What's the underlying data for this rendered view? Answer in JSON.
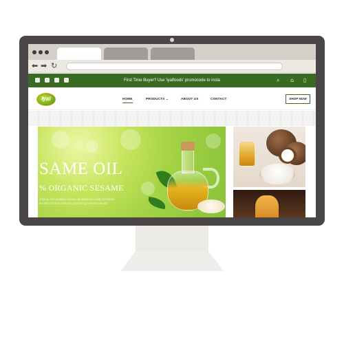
{
  "browser": {
    "nav": {
      "back_icon": "arrow-left-icon",
      "forward_icon": "arrow-right-icon",
      "reload_icon": "reload-icon"
    }
  },
  "site": {
    "announcement": "First Time Buyer? Use 'iyalfoods' promocode to insta",
    "social_icons": [
      "facebook-icon",
      "instagram-icon",
      "youtube-icon",
      "twitter-icon"
    ],
    "utility_icons": [
      "search-icon",
      "account-icon",
      "cart-icon"
    ],
    "logo_text": "Iyal",
    "nav": {
      "home": "HOME",
      "products": "PRODUCTS",
      "products_caret": "⌄",
      "about": "ABOUT US",
      "contact": "CONTACT"
    },
    "shop_now": "SHOP NOW"
  },
  "hero": {
    "title": "SAME OIL",
    "subtitle": "% ORGANIC SESAME",
    "description": "organic cold pressed sesame oil extracted using traditional wooden churner methods preserving natural nutrients"
  },
  "colors": {
    "brand_green": "#3a6b22",
    "monitor_bezel": "#4a4647",
    "hero_green": "#a5d445"
  }
}
